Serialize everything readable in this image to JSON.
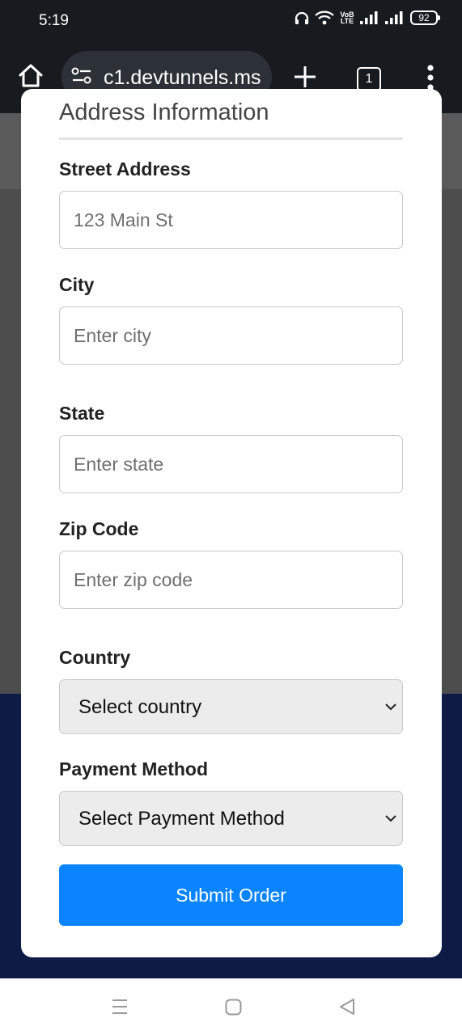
{
  "status_bar": {
    "time": "5:19",
    "volte_label": "VoB LTE",
    "battery": "92"
  },
  "browser": {
    "url": "c1.devtunnels.ms",
    "tab_count": "1"
  },
  "form": {
    "section_title": "Address Information",
    "fields": {
      "street": {
        "label": "Street Address",
        "placeholder": "123 Main St"
      },
      "city": {
        "label": "City",
        "placeholder": "Enter city"
      },
      "state": {
        "label": "State",
        "placeholder": "Enter state"
      },
      "zip": {
        "label": "Zip Code",
        "placeholder": "Enter zip code"
      }
    },
    "country": {
      "label": "Country",
      "selected": "Select country"
    },
    "payment": {
      "label": "Payment Method",
      "selected": "Select Payment Method"
    },
    "submit_label": "Submit Order"
  },
  "colors": {
    "accent": "#0a84ff",
    "footer_navy": "#0e1b45",
    "overlay_gray": "#4d4d4d"
  }
}
